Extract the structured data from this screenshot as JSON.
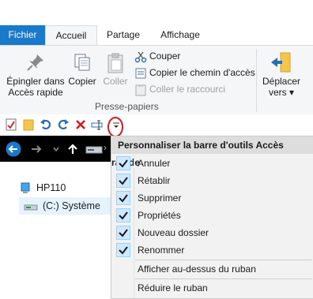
{
  "tabs": {
    "file": "Fichier",
    "home": "Accueil",
    "share": "Partage",
    "view": "Affichage"
  },
  "ribbon": {
    "pin_label_1": "Épingler dans",
    "pin_label_2": "Accès rapide",
    "copy_label": "Copier",
    "paste_label": "Coller",
    "cut_label": "Couper",
    "copy_path_label": "Copier le chemin d'accès",
    "paste_shortcut_label": "Coller le raccourci",
    "clipboard_group": "Presse-papiers",
    "move_label_1": "Déplacer",
    "move_label_2": "vers"
  },
  "nav": {
    "computer": "HP110",
    "drive": "(C:) Système"
  },
  "menu": {
    "header": "Personnaliser la barre d'outils Accès rapide",
    "items": [
      {
        "label": "Annuler",
        "checked": true
      },
      {
        "label": "Rétablir",
        "checked": true
      },
      {
        "label": "Supprimer",
        "checked": true
      },
      {
        "label": "Propriétés",
        "checked": true
      },
      {
        "label": "Nouveau dossier",
        "checked": true
      },
      {
        "label": "Renommer",
        "checked": true
      }
    ],
    "show_above": "Afficher au-dessus du ruban",
    "minimize": "Réduire le ruban"
  },
  "colors": {
    "file_tab": "#1979ca",
    "highlight_circle": "#e0141e",
    "check_bg": "#cde8ff"
  }
}
